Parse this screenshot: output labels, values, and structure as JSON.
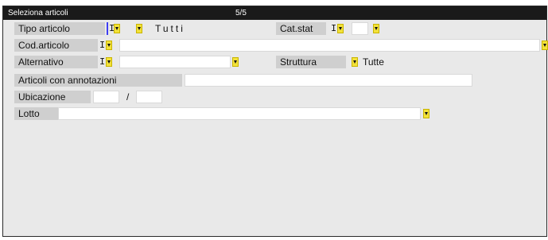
{
  "window": {
    "title": "Seleziona articoli",
    "pager": "5/5"
  },
  "rows": {
    "tipo_articolo": {
      "label": "Tipo articolo",
      "code": "I",
      "value": "Tutti"
    },
    "cat_stat": {
      "label": "Cat.stat",
      "code": "I"
    },
    "cod_articolo": {
      "label": "Cod.articolo",
      "code": "I"
    },
    "alternativo": {
      "label": "Alternativo",
      "code": "I"
    },
    "struttura": {
      "label": "Struttura",
      "value": "Tutte"
    },
    "articoli_annotazioni": {
      "label": "Articoli con annotazioni"
    },
    "ubicazione": {
      "label": "Ubicazione",
      "separator": "/"
    },
    "lotto": {
      "label": "Lotto"
    }
  },
  "icons": {
    "dropdown": "dropdown-arrow-icon"
  },
  "colors": {
    "titlebar": "#1a1a1a",
    "panel": "#e9e9e9",
    "label_bg": "#cfcfcf",
    "dropdown": "#f3e23a"
  }
}
